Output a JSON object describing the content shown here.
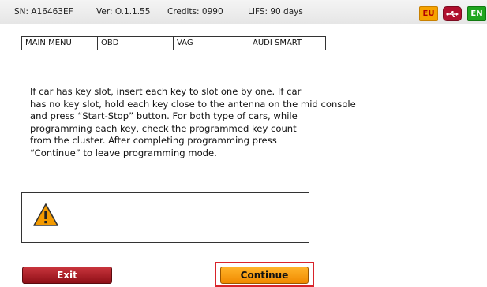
{
  "status": {
    "sn": "SN: A16463EF",
    "ver": "Ver: O.1.1.55",
    "credits": "Credits: 0990",
    "lifs": "LIFS: 90 days"
  },
  "indicators": {
    "eu": "EU",
    "usb_icon": "usb-icon",
    "en": "EN"
  },
  "breadcrumb": [
    "MAIN MENU",
    "OBD",
    "VAG",
    "AUDI SMART"
  ],
  "message_lines": [
    "If car has key slot, insert each key to slot one by one. If car",
    "has no key slot, hold each key close to the antenna on the mid console",
    "and press “Start-Stop” button. For both type of cars, while",
    "programming each key, check the programmed key count",
    "from the cluster. After completing programming press",
    "“Continue” to leave programming mode."
  ],
  "warning_icon": "warning-icon",
  "buttons": {
    "exit": "Exit",
    "continue": "Continue"
  },
  "colors": {
    "exit_button": "#a8161f",
    "continue_button": "#f7a010",
    "highlight_frame": "#d8232a",
    "warning_fill": "#f39a00"
  }
}
